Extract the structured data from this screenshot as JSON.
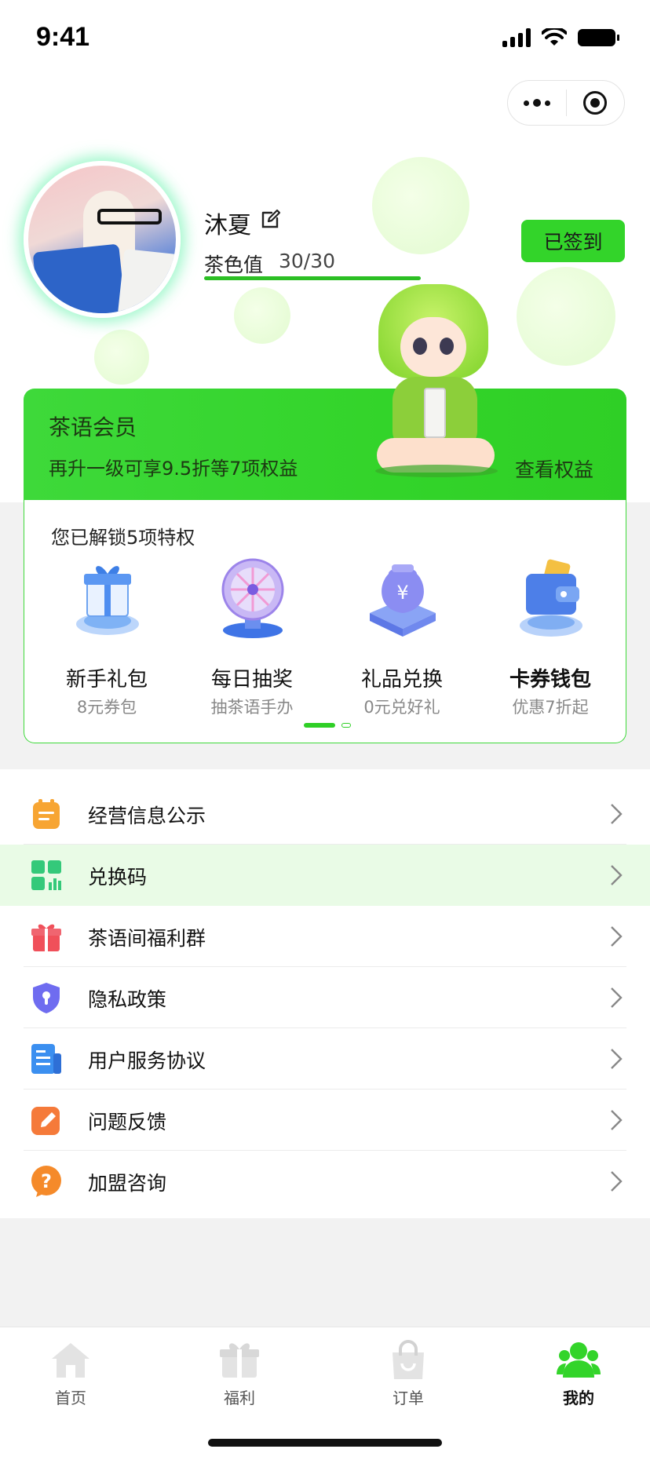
{
  "status": {
    "time": "9:41"
  },
  "profile": {
    "name": "沐夏",
    "tea_label": "茶色值",
    "tea_value": "30/30",
    "tea_progress": 1.0,
    "checkin_label": "已签到"
  },
  "member": {
    "title": "茶语会员",
    "desc": "再升一级可享9.5折等7项权益",
    "link": "查看权益"
  },
  "privileges": {
    "title": "您已解锁5项特权",
    "items": [
      {
        "name": "新手礼包",
        "sub": "8元券包",
        "icon": "gift-box-icon"
      },
      {
        "name": "每日抽奖",
        "sub": "抽茶语手办",
        "icon": "lottery-wheel-icon"
      },
      {
        "name": "礼品兑换",
        "sub": "0元兑好礼",
        "icon": "money-bag-icon"
      },
      {
        "name": "卡券钱包",
        "sub": "优惠7折起",
        "icon": "wallet-icon"
      }
    ],
    "page": 1,
    "pages": 2
  },
  "menu": {
    "items": [
      {
        "label": "经营信息公示",
        "icon": "clipboard-icon",
        "color": "#f7a533"
      },
      {
        "label": "兑换码",
        "icon": "qr-grid-icon",
        "color": "#34c97a"
      },
      {
        "label": "茶语间福利群",
        "icon": "gift-icon",
        "color": "#f0505a"
      },
      {
        "label": "隐私政策",
        "icon": "shield-icon",
        "color": "#6f6cf0"
      },
      {
        "label": "用户服务协议",
        "icon": "document-icon",
        "color": "#3b8ff0"
      },
      {
        "label": "问题反馈",
        "icon": "edit-icon",
        "color": "#f57a3a"
      },
      {
        "label": "加盟咨询",
        "icon": "question-icon",
        "color": "#f58a2a"
      }
    ]
  },
  "tabs": [
    {
      "label": "首页",
      "icon": "home-icon",
      "active": false
    },
    {
      "label": "福利",
      "icon": "gift-icon",
      "active": false
    },
    {
      "label": "订单",
      "icon": "bag-icon",
      "active": false
    },
    {
      "label": "我的",
      "icon": "user-group-icon",
      "active": true
    }
  ],
  "colors": {
    "brand": "#33d42a",
    "brand_dark": "#2cbf24",
    "highlight_row": "#e9fbe6"
  }
}
